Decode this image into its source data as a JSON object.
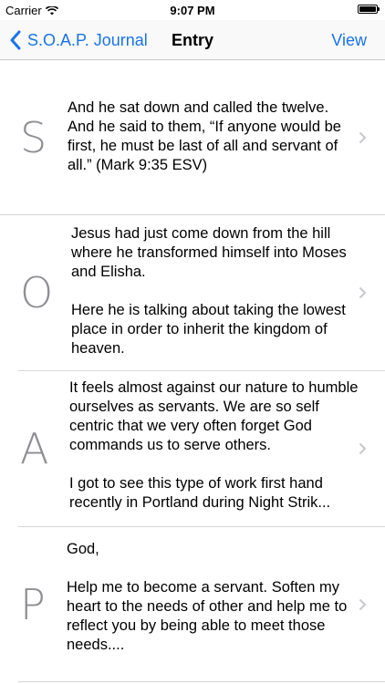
{
  "status_bar": {
    "carrier": "Carrier",
    "time": "9:07 PM"
  },
  "nav": {
    "back_label": "S.O.A.P. Journal",
    "title": "Entry",
    "action_label": "View"
  },
  "entries": [
    {
      "letter": "S",
      "text": "And he sat down and called the twelve. And he said to them, “If anyone would be first, he must be last of all and servant of all.” (Mark 9:35 ESV)"
    },
    {
      "letter": "O",
      "text": "Jesus had just come down from the hill where he transformed himself into Moses and Elisha.\n\nHere he is talking about taking the lowest place in order to inherit the kingdom of heaven."
    },
    {
      "letter": "A",
      "text": "It feels almost against our nature to humble ourselves as servants. We are so self centric that we very often forget God commands us to serve others.\n\nI got to see this type of work first hand recently in Portland during Night Strik..."
    },
    {
      "letter": "P",
      "text": "God,\n\nHelp me to become a servant. Soften my heart to the needs of other and help me to reflect you by being able to meet those needs...."
    }
  ],
  "colors": {
    "accent": "#1a73e8",
    "letter": "#8e8e93",
    "separator": "#d6d6d6"
  }
}
